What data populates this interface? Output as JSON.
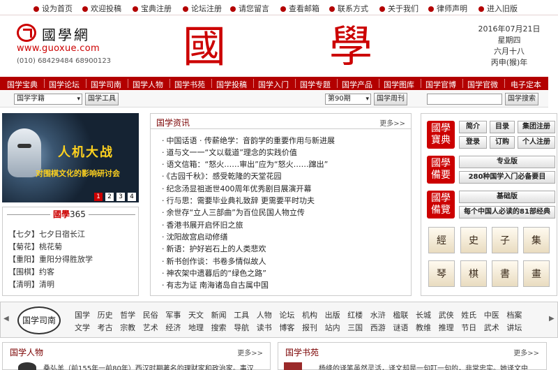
{
  "topnav": [
    "设为首页",
    "欢迎投稿",
    "宝典注册",
    "论坛注册",
    "请您留言",
    "查看邮箱",
    "联系方式",
    "关于我们",
    "律师声明",
    "进入旧版"
  ],
  "logo": {
    "name": "國學網",
    "url": "www.guoxue.com",
    "tel": "(010) 68429484  68900123"
  },
  "hero": {
    "char1": "國",
    "char2": "學"
  },
  "date": {
    "greg": "2016年07月21日",
    "weekday": "星期四",
    "lunar": "六月十八",
    "ganzhi": "丙申(猴)年"
  },
  "mainnav": [
    "国学宝典",
    "国学论坛",
    "国学司南",
    "国学人物",
    "国学书苑",
    "国学投稿",
    "国学入门",
    "国学专题",
    "国学产品",
    "国学图库",
    "国学官博",
    "国学官微",
    "电子定本"
  ],
  "tools": {
    "select1": "国学字籍",
    "btn1": "国学工具",
    "select2": "第90期",
    "btn2": "国学周刊",
    "btn3": "国学搜索"
  },
  "banner": {
    "title": "人机大战",
    "subtitle": "对围棋文化的影响研讨会",
    "pages": [
      "1",
      "2",
      "3",
      "4"
    ]
  },
  "box365": {
    "label_red": "國學",
    "label_num": "365",
    "items": [
      "【七夕】七夕日宿长江",
      "【菊花】桃花菊",
      "【重阳】重阳分得胜放学",
      "【围棋】约客",
      "【清明】清明"
    ]
  },
  "news": {
    "title": "国学资讯",
    "more": "更多>>",
    "items": [
      "中国话语 · 传薪绝学：音韵学的重要作用与新进展",
      "道与文一一“文以载道”理念的实践价值",
      "语文信箱：“怒火……审出”应为“怒火……蹿出”",
      "《古园千秋》：感受乾隆的天堂花园",
      "纪念汤显祖逝世400周年优秀剧目展演开幕",
      "行与思：需要毕业典礼致辞  更需要平时功夫",
      "余世存“立人三部曲”为百位民国人物立传",
      "香港书展开启怀旧之旅",
      "沈阳故宫启动修缮",
      "新语：护好岩石上的人类悲欢",
      "新书创作谈：书卷多情似故人",
      "神农架中遗暮后的“绿色之路”",
      "有志为证  南海诸岛自古属中国"
    ]
  },
  "rightbox": {
    "tags": [
      "國學寶典",
      "國學備要",
      "國學備覽"
    ],
    "buttons": [
      "简介",
      "目录",
      "集团注册",
      "登录",
      "订购",
      "个人注册"
    ],
    "pro_label": "专业版",
    "pro_desc": "280种国学入门必备要目",
    "basic_label": "基础版",
    "basic_desc": "每个中国人必读的81部经典",
    "icons": [
      "經",
      "史",
      "子",
      "集",
      "琴",
      "棋",
      "書",
      "畫"
    ]
  },
  "categories": {
    "seal": "国学司南",
    "row1": [
      "国学",
      "历史",
      "哲学",
      "民俗",
      "军事",
      "天文",
      "新闻",
      "工具",
      "人物",
      "论坛",
      "机构",
      "出版",
      "红楼",
      "水浒",
      "楹联",
      "长城",
      "武侠",
      "姓氏",
      "中医",
      "档案"
    ],
    "row2": [
      "文学",
      "考古",
      "宗教",
      "艺术",
      "经济",
      "地理",
      "搜索",
      "导航",
      "读书",
      "博客",
      "报刊",
      "站内",
      "三国",
      "西游",
      "谜语",
      "教维",
      "推理",
      "节日",
      "武术",
      "讲坛"
    ]
  },
  "people": {
    "title": "国学人物",
    "more": "更多>>",
    "text": "桑弘羊（前155年一前80年）西汉时期著名的理财家和政治家。事汉"
  },
  "books": {
    "title": "国学书苑",
    "more": "更多>>",
    "text": "杨绛的译笔虽然灵活，译文却是一句叮一句的，非常忠实。她译文中"
  }
}
